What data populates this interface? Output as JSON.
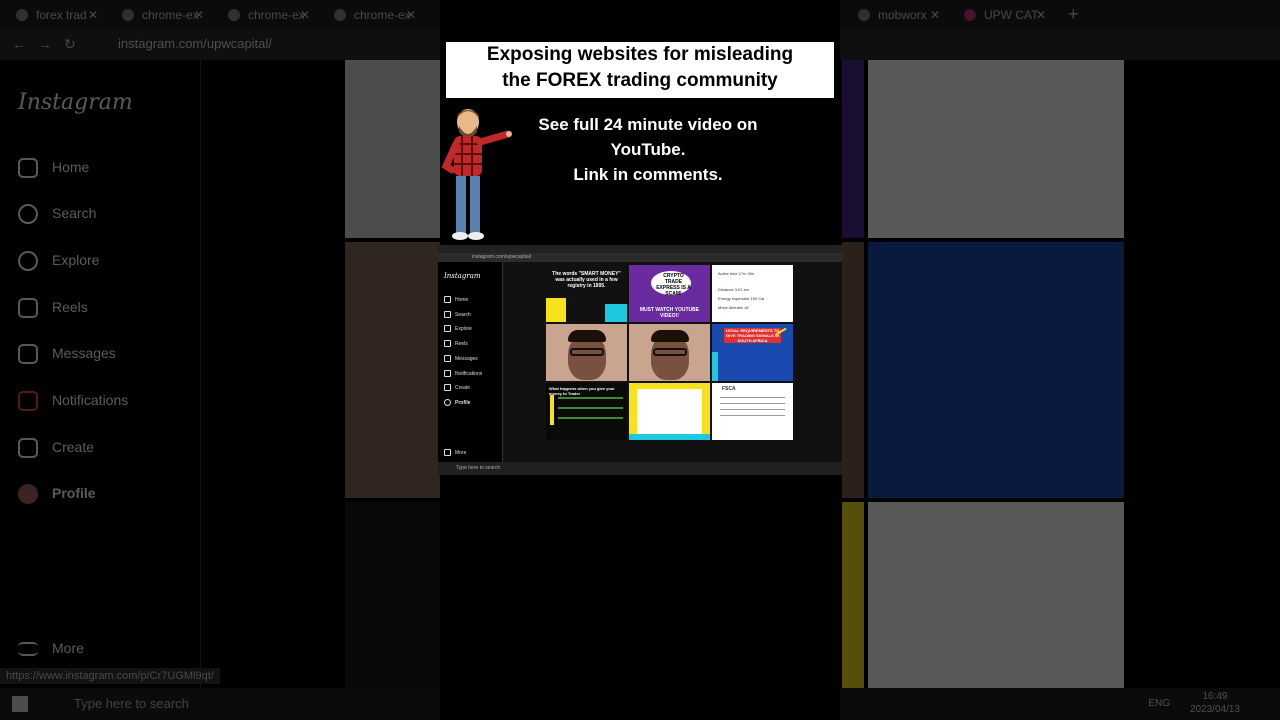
{
  "overlay": {
    "title_line1": "Exposing websites for misleading",
    "title_line2": "the FOREX trading community",
    "sub_line1": "See full 24 minute video on",
    "sub_line2": "YouTube.",
    "sub_line3": "Link in comments."
  },
  "browser": {
    "tabs": [
      "forex trad",
      "chrome-ex",
      "chrome-ex",
      "chrome-ex",
      "mobworx",
      "UPW CAT"
    ],
    "url": "instagram.com/upwcapital/"
  },
  "instagram": {
    "logo": "Instagram",
    "nav": [
      "Home",
      "Search",
      "Explore",
      "Reels",
      "Messages",
      "Notifications",
      "Create",
      "Profile",
      "More"
    ],
    "status_url": "https://www.instagram.com/p/Cr7UGMl9qt/"
  },
  "feed": {
    "smart_money": "The words \"SMART MONEY\" was actually used in a few registry in 1895.",
    "crypto_title": "CRYPTO TRADE EXPRESS IS A SCAM!",
    "crypto_sub": "MUST WATCH YOUTUBE VIDEO!!",
    "stats": [
      {
        "label": "Active time",
        "value": "17m 30s"
      },
      {
        "label": "Distance",
        "value": "3.01 km"
      },
      {
        "label": "Energy expended",
        "value": "190 Cal"
      },
      {
        "label": "Move Minutes",
        "value": "18"
      }
    ],
    "legal_title": "LEGAL REQUIREMENTS TO GIVE TRADING SIGNALS IN SOUTH AFRICA",
    "what_happens": "What happens when you give your money to Trader",
    "fsca": "FSCA"
  },
  "taskbar": {
    "search_placeholder": "Type here to search",
    "lang": "ENG",
    "time": "16:49",
    "date": "2023/04/13"
  },
  "colors": {
    "cyan": "#1ec8e0",
    "yellow": "#f5e21a",
    "purple": "#6a2aa0",
    "navy": "#1a3a8a"
  }
}
